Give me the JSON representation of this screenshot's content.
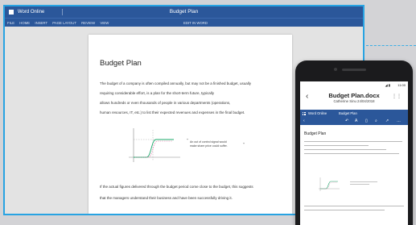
{
  "window": {
    "app_name": "Word Online",
    "doc_title": "Budget Plan"
  },
  "ribbon": {
    "tabs": [
      "FILE",
      "HOME",
      "INSERT",
      "PAGE LAYOUT",
      "REVIEW",
      "VIEW"
    ],
    "edit_in_word": "EDIT IN WORD"
  },
  "document": {
    "heading": "Budget Plan",
    "lines": [
      "The budget of a company is often compiled annually, but may not be a finished budget, usually",
      "requiring considerable effort, is a plan for the short-term future, typically",
      "allows hundreds or even thousands of people in various departments (operations,",
      "human resources, IT, etc.) to list their expected revenues and expenses in the final budget."
    ],
    "caption_quote_open": "“",
    "caption_lines": [
      "An out of control signal would",
      "make share price could suffer."
    ],
    "caption_quote_close": "”",
    "closing_lines": [
      "If the actual figures delivered through the budget period come close to the budget, this suggests",
      "that the managers understand their business and have been successfully driving it."
    ]
  },
  "phone": {
    "status_time": "11:00",
    "status_signals": "◢ ▮",
    "back_glyph": "‹",
    "doc_name": "Budget Plan.docx",
    "author_line": "Catherine Sinu 24/04/2018",
    "menu_glyph": "⋮⋮",
    "bar_app": "Word Online",
    "bar_title": "Budget Plan",
    "tools": [
      "‹",
      "↶",
      "A",
      "▯",
      "⌕",
      "↗",
      "…"
    ],
    "doc_heading": "Budget Plan"
  },
  "colors": {
    "accent_blue": "#2b579a",
    "window_border": "#28a3e2",
    "chart_green": "#1aa86a",
    "chart_pink": "#e0669a"
  }
}
